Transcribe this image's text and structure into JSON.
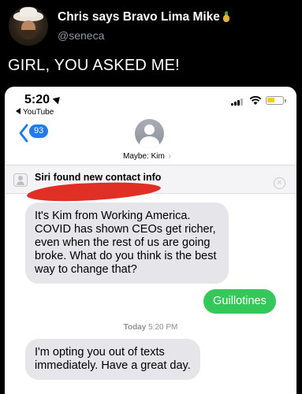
{
  "tweet": {
    "display_name": "Chris says Bravo Lima Mike",
    "name_emoji_icon": "pineapple-icon",
    "handle": "@seneca",
    "text": "GIRL, YOU ASKED ME!"
  },
  "phone": {
    "status_bar": {
      "time": "5:20",
      "back_app": "YouTube",
      "battery_color": "#f2cc1b"
    },
    "nav": {
      "unread_count": "93",
      "contact_name": "Maybe: Kim",
      "chevron": "›"
    },
    "siri_banner": {
      "title": "Siri found new contact info",
      "close_glyph": "×"
    },
    "messages": [
      {
        "direction": "incoming",
        "text": "It's Kim from Working America. COVID has shown CEOs get richer, even when the rest of us are going broke. What do you think is the best way to change that?"
      },
      {
        "direction": "outgoing",
        "text": "Guillotines"
      },
      {
        "direction": "incoming",
        "text": "I'm opting you out of texts immediately. Have a great day."
      }
    ],
    "timestamp": {
      "day": "Today",
      "time": "5:20 PM"
    }
  },
  "colors": {
    "outgoing_bubble": "#35c759",
    "incoming_bubble": "#e5e5ea",
    "accent_blue": "#1e7cf2",
    "redaction": "#e02f25"
  }
}
